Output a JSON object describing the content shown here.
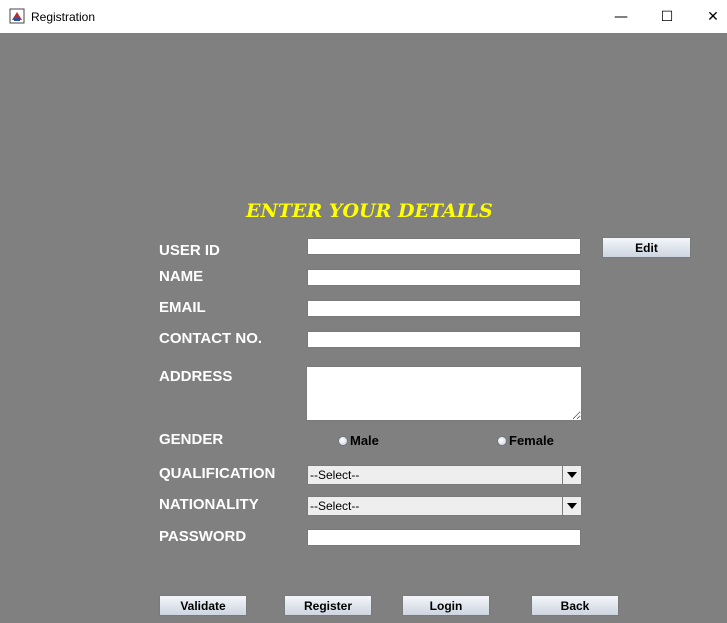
{
  "window": {
    "title": "Registration",
    "minimize_glyph": "—",
    "maximize_glyph": "☐",
    "close_glyph": "✕"
  },
  "form": {
    "heading": "ENTER YOUR DETAILS",
    "labels": {
      "user_id": "USER ID",
      "name": "NAME",
      "email": "EMAIL",
      "contact": "CONTACT NO.",
      "address": "ADDRESS",
      "gender": "GENDER",
      "qualification": "QUALIFICATION",
      "nationality": "NATIONALITY",
      "password": "PASSWORD"
    },
    "values": {
      "user_id": "",
      "name": "",
      "email": "",
      "contact": "",
      "address": "",
      "password": ""
    },
    "gender_options": {
      "male": "Male",
      "female": "Female"
    },
    "qualification_selected": "--Select--",
    "nationality_selected": "--Select--",
    "edit_label": "Edit"
  },
  "buttons": {
    "validate": "Validate",
    "register": "Register",
    "login": "Login",
    "back": "Back"
  },
  "icons": {
    "app": "java-app-icon",
    "dropdown": "triangle-down-icon",
    "radio": "radio-unselected-icon"
  },
  "colors": {
    "background": "#808080",
    "heading": "#ffff00",
    "label": "#ffffff"
  }
}
